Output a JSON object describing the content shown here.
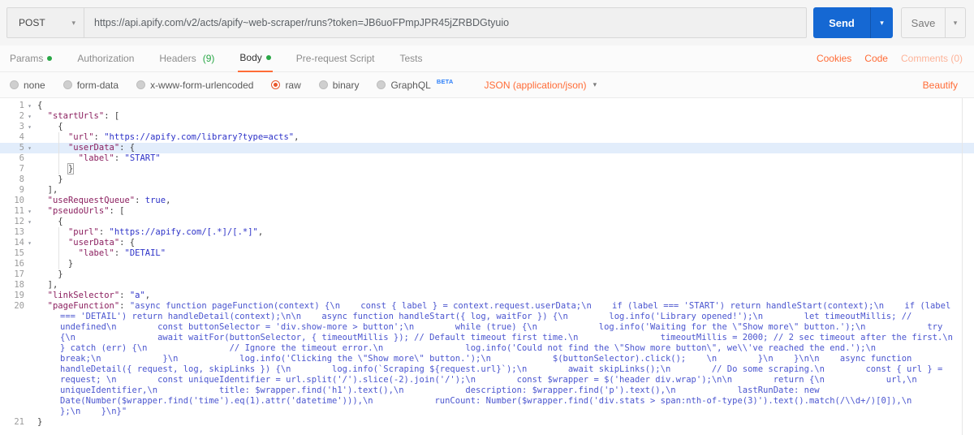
{
  "request": {
    "method": "POST",
    "url": "https://api.apify.com/v2/acts/apify~web-scraper/runs?token=JB6uoFPmpJPR45jZRBDGtyuio",
    "send_label": "Send",
    "save_label": "Save"
  },
  "tabs": {
    "items": [
      {
        "label": "Params",
        "dot": true
      },
      {
        "label": "Authorization"
      },
      {
        "label": "Headers",
        "count": "(9)"
      },
      {
        "label": "Body",
        "dot": true,
        "active": true
      },
      {
        "label": "Pre-request Script"
      },
      {
        "label": "Tests"
      }
    ],
    "right": {
      "cookies": "Cookies",
      "code": "Code",
      "comments": "Comments (0)"
    }
  },
  "body_bar": {
    "options": [
      {
        "label": "none"
      },
      {
        "label": "form-data"
      },
      {
        "label": "x-www-form-urlencoded"
      },
      {
        "label": "raw",
        "selected": true
      },
      {
        "label": "binary"
      },
      {
        "label": "GraphQL",
        "beta": "BETA"
      }
    ],
    "content_type": "JSON (application/json)",
    "beautify": "Beautify"
  },
  "colors": {
    "accent_orange": "#ff6c37",
    "green_dot": "#29a746",
    "send_blue": "#1568d3",
    "beta_blue": "#2d7ff9",
    "key_color": "#8b1f5f",
    "string_color": "#2d32c8",
    "line_highlight": "#e2edfb"
  },
  "editor": {
    "lines": [
      {
        "n": "1",
        "f": 1,
        "parts": [
          [
            "p",
            "{"
          ]
        ]
      },
      {
        "n": "2",
        "f": 1,
        "parts": [
          [
            "p",
            "  "
          ],
          [
            "k",
            "\"startUrls\""
          ],
          [
            "p",
            ": ["
          ]
        ]
      },
      {
        "n": "3",
        "f": 1,
        "parts": [
          [
            "p",
            "    {"
          ]
        ]
      },
      {
        "n": "4",
        "g": 29,
        "parts": [
          [
            "p",
            "      "
          ],
          [
            "k",
            "\"url\""
          ],
          [
            "p",
            ": "
          ],
          [
            "s",
            "\"https://apify.com/library?type=acts\""
          ],
          [
            "p",
            ","
          ]
        ]
      },
      {
        "n": "5",
        "f": 1,
        "h": 1,
        "g": 29,
        "parts": [
          [
            "p",
            "      "
          ],
          [
            "k",
            "\"userData\""
          ],
          [
            "p",
            ": {"
          ]
        ]
      },
      {
        "n": "6",
        "g": 29,
        "parts": [
          [
            "p",
            "        "
          ],
          [
            "k",
            "\"label\""
          ],
          [
            "p",
            ": "
          ],
          [
            "s",
            "\"START\""
          ]
        ]
      },
      {
        "n": "7",
        "g": 29,
        "parts": [
          [
            "p",
            "      "
          ],
          [
            "x",
            "}"
          ]
        ]
      },
      {
        "n": "8",
        "parts": [
          [
            "p",
            "    }"
          ]
        ]
      },
      {
        "n": "9",
        "parts": [
          [
            "p",
            "  ],"
          ]
        ]
      },
      {
        "n": "10",
        "parts": [
          [
            "p",
            "  "
          ],
          [
            "k",
            "\"useRequestQueue\""
          ],
          [
            "p",
            ": "
          ],
          [
            "v",
            "true"
          ],
          [
            "p",
            ","
          ]
        ]
      },
      {
        "n": "11",
        "f": 1,
        "parts": [
          [
            "p",
            "  "
          ],
          [
            "k",
            "\"pseudoUrls\""
          ],
          [
            "p",
            ": ["
          ]
        ]
      },
      {
        "n": "12",
        "f": 1,
        "parts": [
          [
            "p",
            "    {"
          ]
        ]
      },
      {
        "n": "13",
        "g": 29,
        "parts": [
          [
            "p",
            "      "
          ],
          [
            "k",
            "\"purl\""
          ],
          [
            "p",
            ": "
          ],
          [
            "s",
            "\"https://apify.com/[.*]/[.*]\""
          ],
          [
            "p",
            ","
          ]
        ]
      },
      {
        "n": "14",
        "f": 1,
        "g": 29,
        "parts": [
          [
            "p",
            "      "
          ],
          [
            "k",
            "\"userData\""
          ],
          [
            "p",
            ": {"
          ]
        ]
      },
      {
        "n": "15",
        "g": 29,
        "parts": [
          [
            "p",
            "        "
          ],
          [
            "k",
            "\"label\""
          ],
          [
            "p",
            ": "
          ],
          [
            "s",
            "\"DETAIL\""
          ]
        ]
      },
      {
        "n": "16",
        "g": 29,
        "parts": [
          [
            "p",
            "      }"
          ]
        ]
      },
      {
        "n": "17",
        "parts": [
          [
            "p",
            "    }"
          ]
        ]
      },
      {
        "n": "18",
        "parts": [
          [
            "p",
            "  ],"
          ]
        ]
      },
      {
        "n": "19",
        "parts": [
          [
            "p",
            "  "
          ],
          [
            "k",
            "\"linkSelector\""
          ],
          [
            "p",
            ": "
          ],
          [
            "s",
            "\"a\""
          ],
          [
            "p",
            ","
          ]
        ]
      },
      {
        "n": "20",
        "w": 1,
        "parts": [
          [
            "p",
            "  "
          ],
          [
            "k",
            "\"pageFunction\""
          ],
          [
            "p",
            ": "
          ],
          [
            "f",
            "\"async function pageFunction(context) {\\n    const { label } = context.request.userData;\\n    if (label === 'START') return handleStart(context);\\n    if (label === 'DETAIL') return handleDetail(context);\\n\\n    async function handleStart({ log, waitFor }) {\\n        log.info('Library opened!');\\n        let timeoutMillis; // undefined\\n        const buttonSelector = 'div.show-more > button';\\n        while (true) {\\n            log.info('Waiting for the \\\"Show more\\\" button.');\\n            try {\\n                await waitFor(buttonSelector, { timeoutMillis }); // Default timeout first time.\\n                timeoutMillis = 2000; // 2 sec timeout after the first.\\n            } catch (err) {\\n                // Ignore the timeout error.\\n                log.info('Could not find the \\\"Show more button\\\", we\\\\'ve reached the end.');\\n                break;\\n            }\\n            log.info('Clicking the \\\"Show more\\\" button.');\\n            $(buttonSelector).click();    \\n        }\\n    }\\n\\n    async function handleDetail({ request, log, skipLinks }) {\\n        log.info(`Scraping ${request.url}`);\\n        await skipLinks();\\n        // Do some scraping.\\n        const { url } = request; \\n        const uniqueIdentifier = url.split('/').slice(-2).join('/');\\n        const $wrapper = $('header div.wrap');\\n\\n        return {\\n            url,\\n            uniqueIdentifier,\\n            title: $wrapper.find('h1').text(),\\n            description: $wrapper.find('p').text(),\\n            lastRunDate: new Date(Number($wrapper.find('time').eq(1).attr('datetime'))),\\n            runCount: Number($wrapper.find('div.stats > span:nth-of-type(3)').text().match(/\\\\d+/)[0]),\\n        };\\n    }\\n}\""
          ]
        ]
      },
      {
        "n": "21",
        "parts": [
          [
            "p",
            "}"
          ]
        ]
      }
    ]
  }
}
